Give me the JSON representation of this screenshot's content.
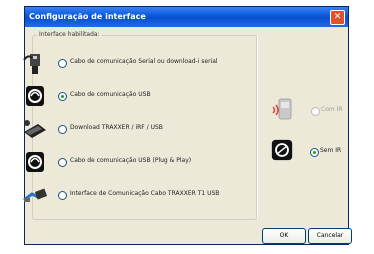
{
  "window": {
    "title": "Configuração de interface",
    "close_label": "✕"
  },
  "group": {
    "label": "Interface habilitada:"
  },
  "options": [
    {
      "label": "Cabo de comunicação Serial ou download-i serial",
      "checked": false
    },
    {
      "label": "Cabo de comunicação USB",
      "checked": true
    },
    {
      "label": "Download TRAXXER / iRF / USB",
      "checked": false
    },
    {
      "label": "Cabo de comunicação USB (Plug & Play)",
      "checked": false
    },
    {
      "label": "Interface de Comunicação Cabo TRAXXER T1 USB",
      "checked": false
    }
  ],
  "ir_options": [
    {
      "label": "Com IR",
      "checked": false,
      "enabled": false
    },
    {
      "label": "Sem IR",
      "checked": true,
      "enabled": true
    }
  ],
  "buttons": {
    "ok": "OK",
    "cancel": "Cancelar"
  }
}
